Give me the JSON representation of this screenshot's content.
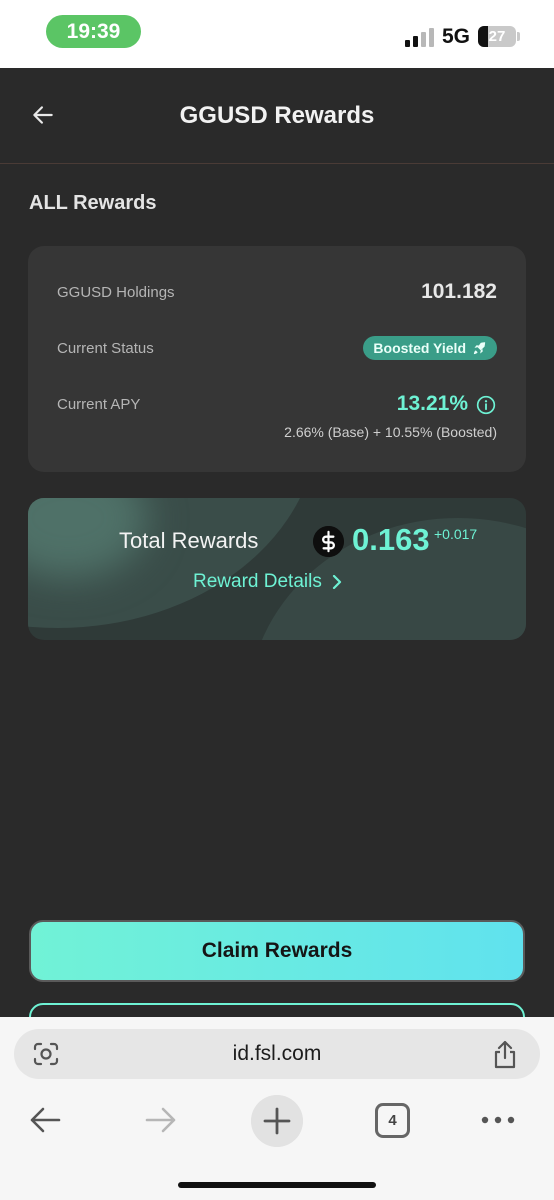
{
  "status_bar": {
    "time": "19:39",
    "network": "5G",
    "battery": "27",
    "battery_level": 0.27
  },
  "header": {
    "title": "GGUSD Rewards"
  },
  "section": {
    "title": "ALL Rewards"
  },
  "info": {
    "holdings_label": "GGUSD Holdings",
    "holdings_value": "101.182",
    "status_label": "Current Status",
    "status_badge": "Boosted Yield",
    "apy_label": "Current APY",
    "apy_value": "13.21%",
    "apy_breakdown": "2.66% (Base) + 10.55% (Boosted)"
  },
  "rewards": {
    "label": "Total Rewards",
    "amount": "0.163",
    "delta": "+0.017",
    "details_link": "Reward Details"
  },
  "actions": {
    "claim": "Claim Rewards"
  },
  "browser": {
    "url": "id.fsl.com",
    "tab_count": "4"
  },
  "colors": {
    "accent": "#6ef2d4",
    "background": "#2a2a2a",
    "card": "#363636",
    "badge": "#3a9d88"
  }
}
